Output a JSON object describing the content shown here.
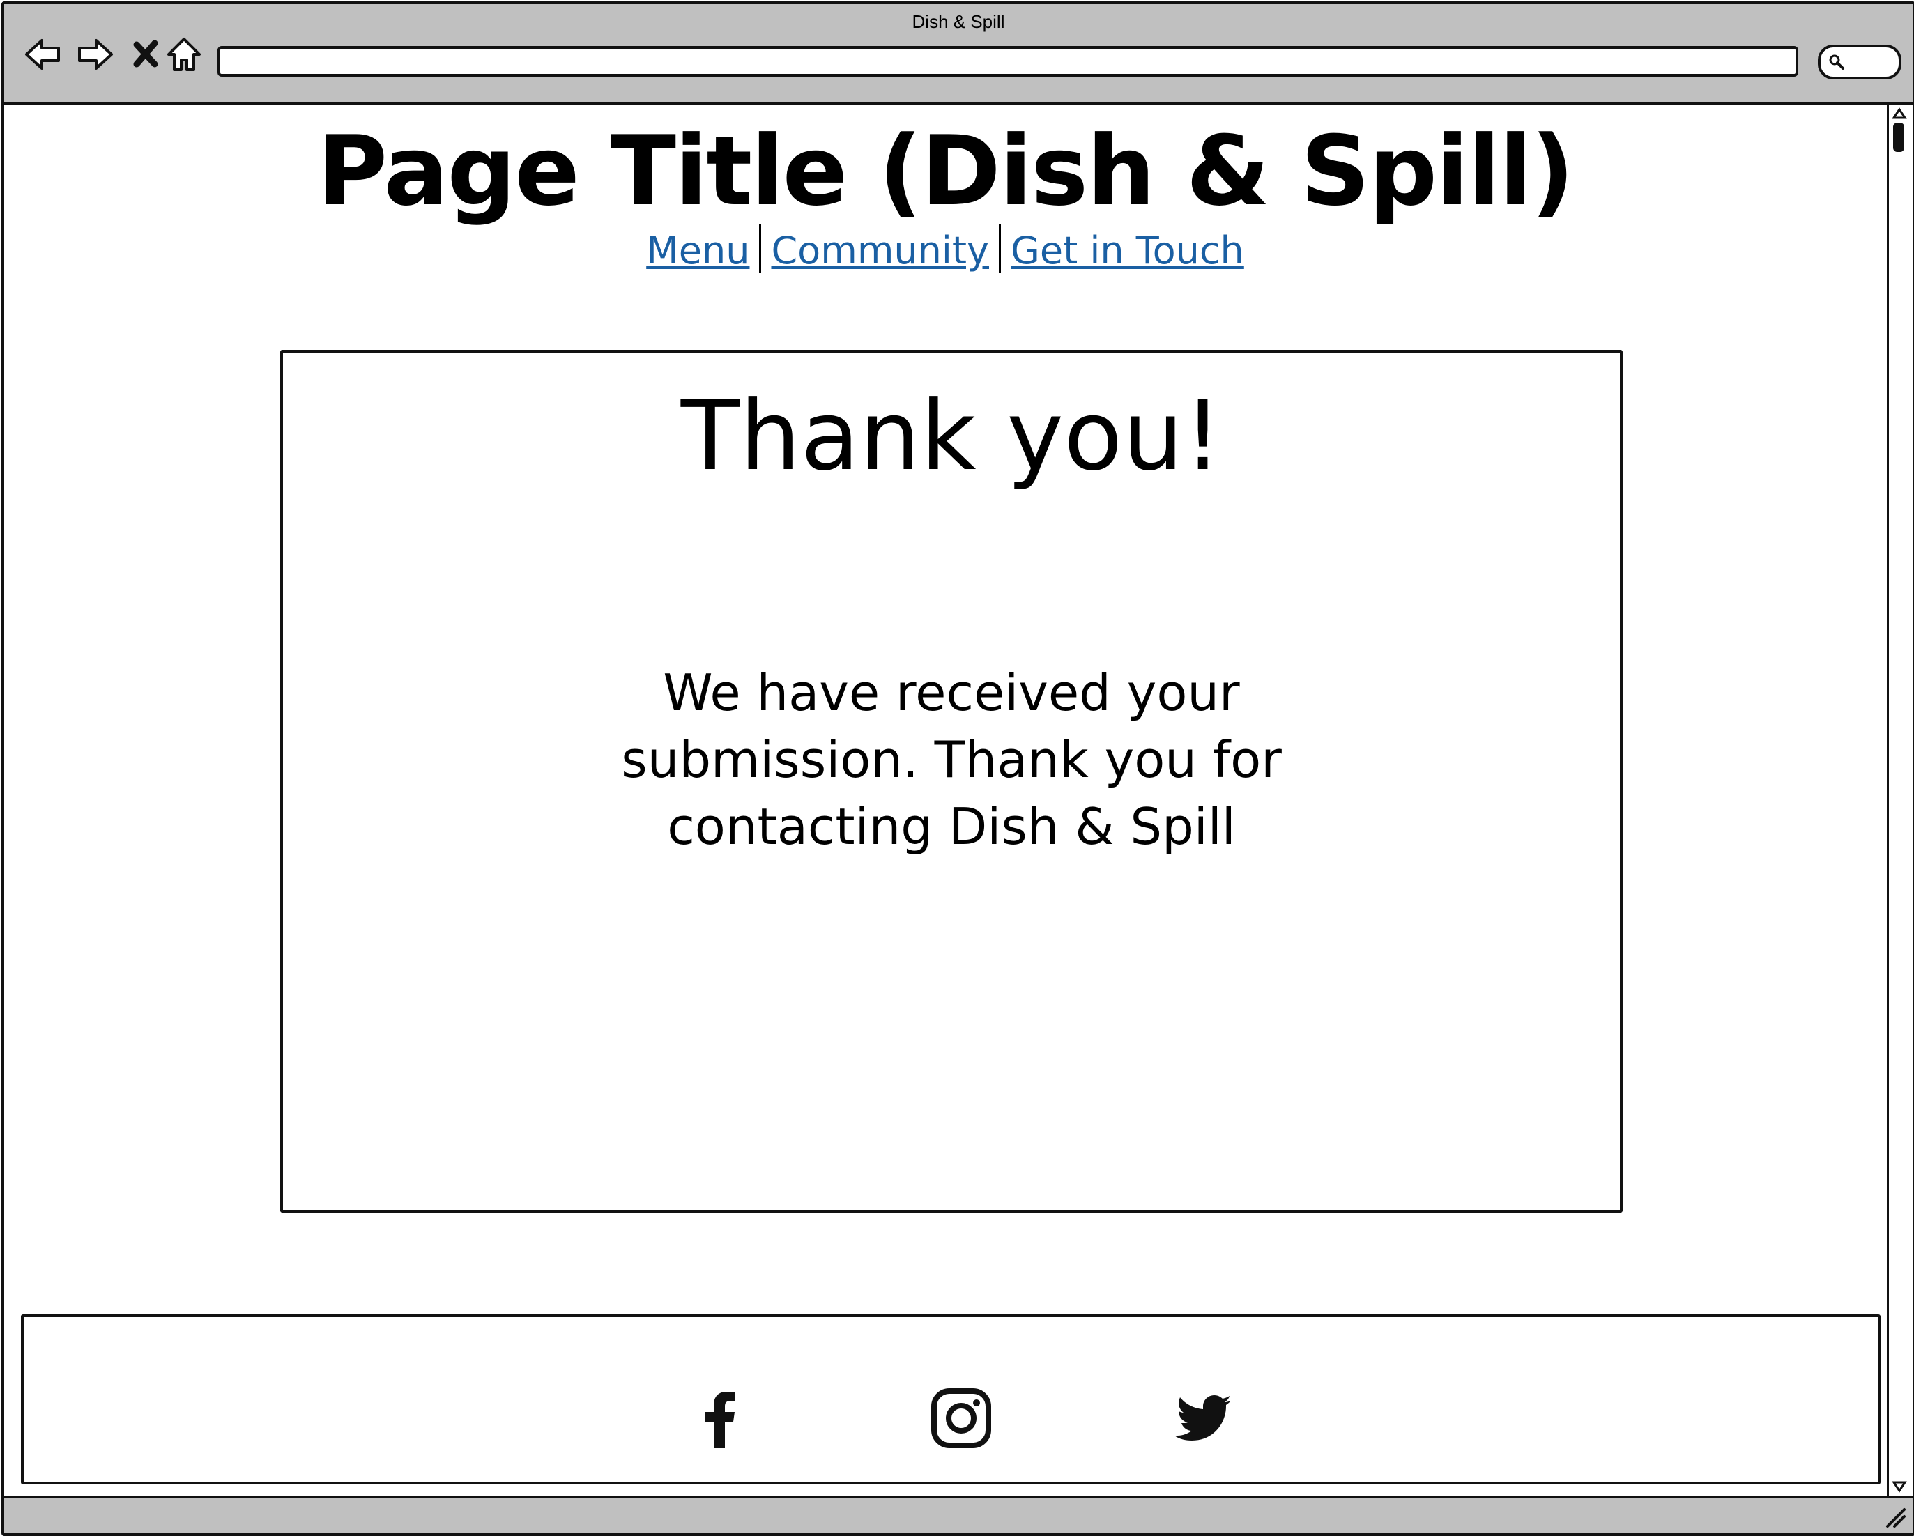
{
  "window": {
    "title": "Dish & Spill"
  },
  "browser": {
    "back_icon": "back-arrow-icon",
    "forward_icon": "forward-arrow-icon",
    "stop_icon": "close-icon",
    "home_icon": "home-icon",
    "address_value": "",
    "search_icon": "search-icon"
  },
  "header": {
    "title": "Page Title (Dish & Spill)",
    "nav": [
      {
        "label": "Menu"
      },
      {
        "label": "Community"
      },
      {
        "label": "Get in Touch"
      }
    ]
  },
  "main": {
    "heading": "Thank you!",
    "message_lines": [
      "We have received your",
      "submission. Thank you for",
      "contacting Dish & Spill"
    ]
  },
  "footer": {
    "social": [
      {
        "icon": "facebook-icon"
      },
      {
        "icon": "instagram-icon"
      },
      {
        "icon": "twitter-icon"
      }
    ]
  },
  "colors": {
    "link": "#1a5fa3",
    "chrome": "#c0c0c0",
    "border": "#111111"
  }
}
